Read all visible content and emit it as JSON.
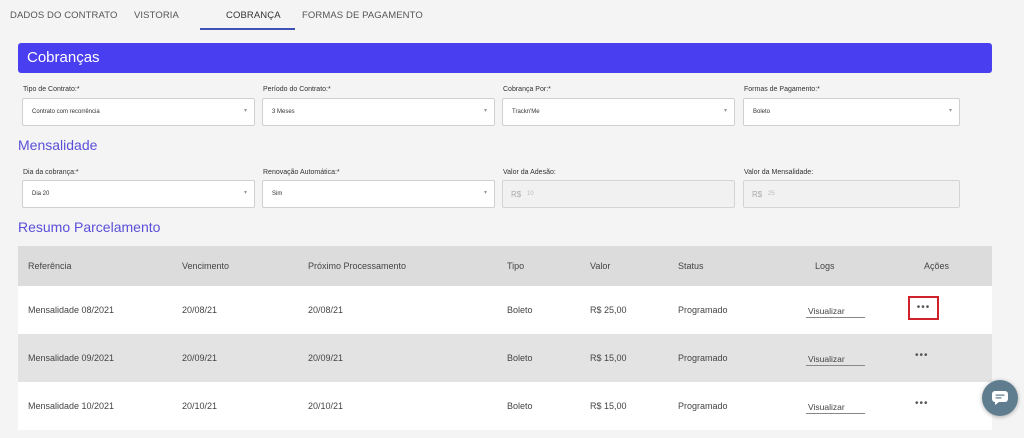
{
  "tabs": [
    {
      "label": "DADOS DO CONTRATO",
      "active": false
    },
    {
      "label": "VISTORIA",
      "active": false
    },
    {
      "label": "COBRANÇA",
      "active": true
    },
    {
      "label": "FORMAS DE PAGAMENTO",
      "active": false
    }
  ],
  "cobrancas": {
    "title": "Cobranças",
    "fields": [
      {
        "label": "Tipo de Contrato:*",
        "value": "Contrato com recorrência"
      },
      {
        "label": "Período do Contrato:*",
        "value": "3 Meses"
      },
      {
        "label": "Cobrança Por:*",
        "value": "Trackn'Me"
      },
      {
        "label": "Formas de Pagamento:*",
        "value": "Boleto"
      }
    ]
  },
  "mensalidade": {
    "title": "Mensalidade",
    "fields": [
      {
        "label": "Dia da cobrança:*",
        "value": "Dia 20"
      },
      {
        "label": "Renovação Automática:*",
        "value": "Sim"
      },
      {
        "label": "Valor da Adesão:",
        "prefix": "R$",
        "value": "10"
      },
      {
        "label": "Valor da Mensalidade:",
        "prefix": "R$",
        "value": "25"
      }
    ]
  },
  "resumo": {
    "title": "Resumo Parcelamento",
    "columns": [
      "Referência",
      "Vencimento",
      "Próximo Processamento",
      "Tipo",
      "Valor",
      "Status",
      "Logs",
      "Ações"
    ],
    "rows": [
      {
        "referencia": "Mensalidade 08/2021",
        "vencimento": "20/08/21",
        "proximo": "20/08/21",
        "tipo": "Boleto",
        "valor": "R$ 25,00",
        "status": "Programado",
        "logs": "Visualizar",
        "acoes": "•••"
      },
      {
        "referencia": "Mensalidade 09/2021",
        "vencimento": "20/09/21",
        "proximo": "20/09/21",
        "tipo": "Boleto",
        "valor": "R$ 15,00",
        "status": "Programado",
        "logs": "Visualizar",
        "acoes": "•••"
      },
      {
        "referencia": "Mensalidade 10/2021",
        "vencimento": "20/10/21",
        "proximo": "20/10/21",
        "tipo": "Boleto",
        "valor": "R$ 15,00",
        "status": "Programado",
        "logs": "Visualizar",
        "acoes": "•••"
      }
    ]
  },
  "icons": {
    "dropdown": "chevron-down-icon",
    "chat": "chat-icon"
  },
  "colors": {
    "header": "#4a3ff0",
    "section_title": "#5a4fd8",
    "tab_underline": "#3f51b5",
    "highlight_border": "#d0222a",
    "chat_button": "#5f7d8e"
  }
}
